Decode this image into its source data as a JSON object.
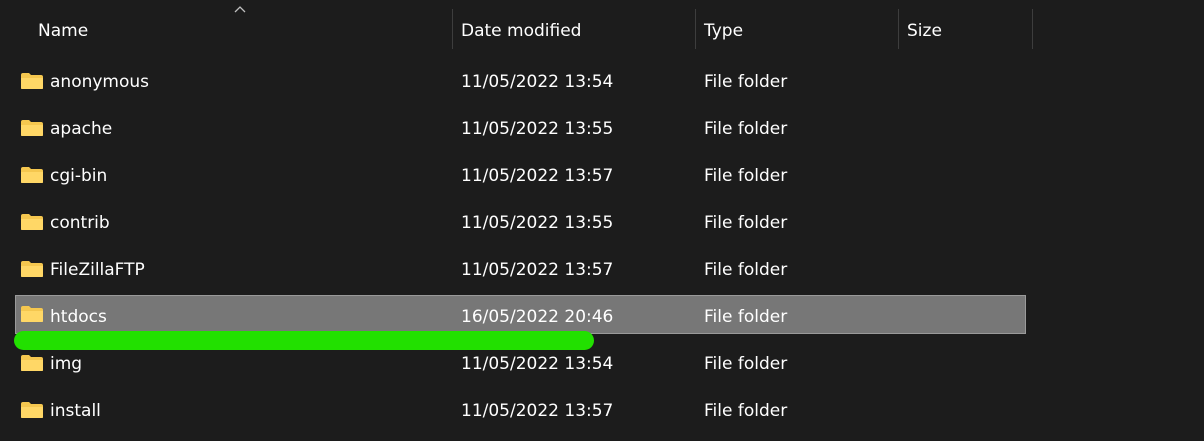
{
  "columns": {
    "name": "Name",
    "date_modified": "Date modified",
    "type": "Type",
    "size": "Size"
  },
  "sort": {
    "column": "name",
    "direction": "ascending",
    "icon": "chevron-up-icon"
  },
  "files": [
    {
      "name": "anonymous",
      "date": "11/05/2022 13:54",
      "type": "File folder",
      "size": "",
      "selected": false
    },
    {
      "name": "apache",
      "date": "11/05/2022 13:55",
      "type": "File folder",
      "size": "",
      "selected": false
    },
    {
      "name": "cgi-bin",
      "date": "11/05/2022 13:57",
      "type": "File folder",
      "size": "",
      "selected": false
    },
    {
      "name": "contrib",
      "date": "11/05/2022 13:55",
      "type": "File folder",
      "size": "",
      "selected": false
    },
    {
      "name": "FileZillaFTP",
      "date": "11/05/2022 13:57",
      "type": "File folder",
      "size": "",
      "selected": false
    },
    {
      "name": "htdocs",
      "date": "16/05/2022 20:46",
      "type": "File folder",
      "size": "",
      "selected": true
    },
    {
      "name": "img",
      "date": "11/05/2022 13:54",
      "type": "File folder",
      "size": "",
      "selected": false
    },
    {
      "name": "install",
      "date": "11/05/2022 13:57",
      "type": "File folder",
      "size": "",
      "selected": false
    }
  ],
  "icons": {
    "folder": "folder-icon"
  },
  "colors": {
    "background": "#1c1c1c",
    "selected_row": "#777777",
    "folder": "#f5c74f",
    "highlight_stroke": "#22e000"
  }
}
